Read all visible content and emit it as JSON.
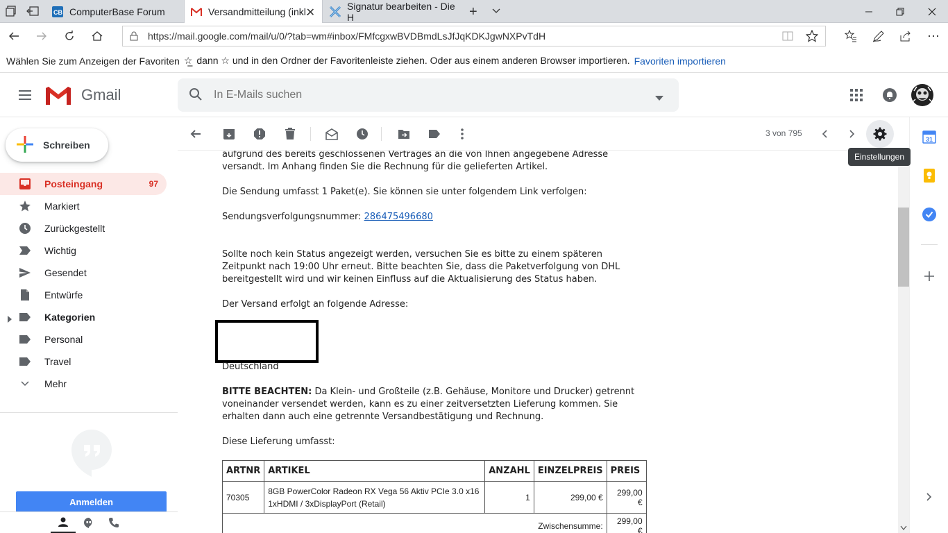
{
  "browser": {
    "tabs": [
      {
        "title": "ComputerBase Forum",
        "icon": "computerbase-favicon"
      },
      {
        "title": "Versandmitteilung (inkl.",
        "icon": "gmail-favicon",
        "active": true
      },
      {
        "title": "Signatur bearbeiten - Die H",
        "icon": "x-favicon"
      }
    ],
    "url": "https://mail.google.com/mail/u/0/?tab=wm#inbox/FMfcgxwBVDBmdLsJfJqKDKJgwNXPvTdH",
    "favorites_bar": {
      "text_before": "Wählen Sie zum Anzeigen der Favoriten",
      "text_after": "dann ☆ und in den Ordner der Favoritenleiste ziehen. Oder aus einem anderen Browser importieren.",
      "link": "Favoriten importieren"
    }
  },
  "gmail": {
    "logo_text": "Gmail",
    "search_placeholder": "In E-Mails suchen",
    "compose_label": "Schreiben",
    "nav": [
      {
        "label": "Posteingang",
        "count": "97",
        "icon": "inbox-icon",
        "active": true
      },
      {
        "label": "Markiert",
        "icon": "star-icon"
      },
      {
        "label": "Zurückgestellt",
        "icon": "clock-icon"
      },
      {
        "label": "Wichtig",
        "icon": "important-icon"
      },
      {
        "label": "Gesendet",
        "icon": "send-icon"
      },
      {
        "label": "Entwürfe",
        "icon": "draft-icon"
      },
      {
        "label": "Kategorien",
        "icon": "label-icon",
        "bold": true
      },
      {
        "label": "Personal",
        "icon": "label-icon"
      },
      {
        "label": "Travel",
        "icon": "label-icon"
      },
      {
        "label": "Mehr",
        "icon": "chevron-down-icon"
      }
    ],
    "hangouts_signin": "Anmelden",
    "pagination": "3 von 795",
    "tooltip": "Einstellungen"
  },
  "email": {
    "p1": "aufgrund des bereits geschlossenen Vertrages an die von Ihnen angegebene Adresse versandt. Im Anhang finden Sie die Rechnung für die gelieferten Artikel.",
    "p2": "Die Sendung umfasst 1 Paket(e). Sie können sie unter folgendem Link verfolgen:",
    "tracking_label": "Sendungsverfolgungsnummer:",
    "tracking_number": "286475496680",
    "p3": "Sollte noch kein Status angezeigt werden, versuchen Sie es bitte zu einem späteren Zeitpunkt nach 19:00 Uhr erneut. Bitte beachten Sie, dass die Paketverfolgung von DHL bereitgestellt wird und wir keinen Einfluss auf die Aktualisierung des Status haben.",
    "p4": "Der Versand erfolgt an folgende Adresse:",
    "country": "Deutschland",
    "note_bold": "BITTE BEACHTEN:",
    "note_text": "Da Klein- und Großteile (z.B. Gehäuse, Monitore und Drucker) getrennt voneinander versendet werden, kann es zu einer zeitversetzten Lieferung kommen. Sie erhalten dann auch eine getrennte Versandbestätigung und Rechnung.",
    "p5": "Diese Lieferung umfasst:",
    "table": {
      "headers": [
        "ARTNR",
        "ARTIKEL",
        "ANZAHL",
        "EINZELPREIS",
        "PREIS"
      ],
      "row": [
        "70305",
        "8GB PowerColor Radeon RX Vega 56 Aktiv PCIe 3.0 x16 1xHDMI / 3xDisplayPort (Retail)",
        "1",
        "299,00 €",
        "299,00 €"
      ],
      "subtotal_label": "Zwischensumme:",
      "subtotal_value": "299,00 €"
    }
  },
  "colors": {
    "gmail_red": "#d93025",
    "active_bg": "#fce8e6",
    "link_blue": "#1a5eb8",
    "signin_blue": "#4285f4"
  }
}
